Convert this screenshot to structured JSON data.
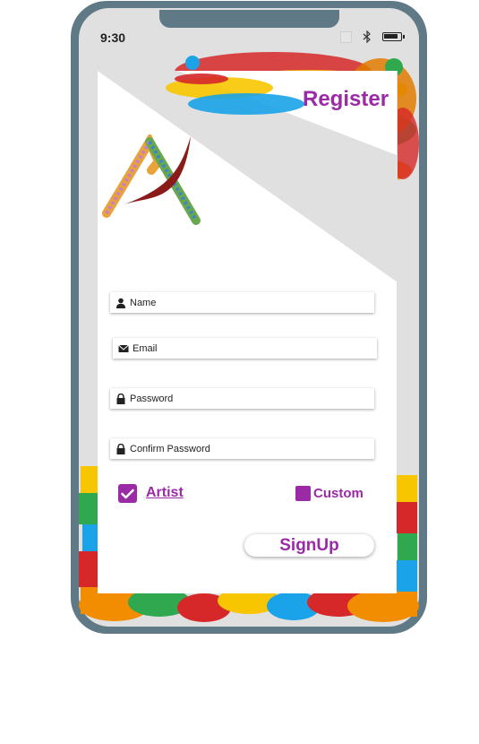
{
  "status_bar": {
    "time": "9:30"
  },
  "header": {
    "title": "Register"
  },
  "form": {
    "name_placeholder": "Name",
    "email_placeholder": "Email",
    "password_placeholder": "Password",
    "confirm_password_placeholder": "Confirm Password"
  },
  "roles": {
    "artist_label": "Artist",
    "artist_checked": true,
    "customer_label": "Customer",
    "customer_checked": false
  },
  "signup_label": "SignUp",
  "colors": {
    "accent": "#9b2aa6",
    "frame": "#5f7a86",
    "background": "#e0e0e0"
  },
  "icons": [
    "user-icon",
    "envelope-icon",
    "lock-icon",
    "check-icon",
    "bluetooth-icon",
    "battery-icon"
  ]
}
